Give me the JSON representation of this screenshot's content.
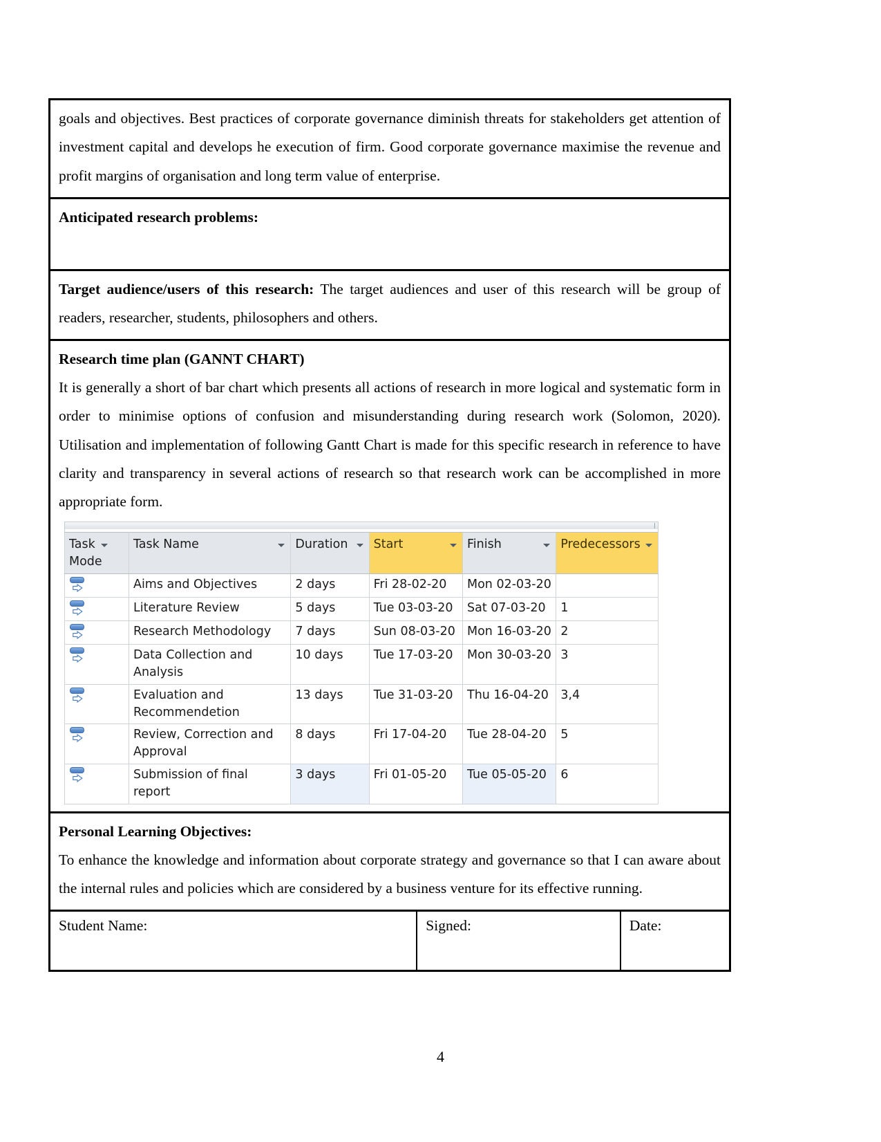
{
  "document": {
    "page_number": "4",
    "sections": {
      "intro_paragraph": "goals and objectives. Best practices of corporate governance diminish threats for stakeholders get attention of investment capital and develops he execution of firm. Good corporate governance maximise the revenue and profit margins of organisation and long term value of enterprise.",
      "anticipated_heading": "Anticipated research problems:",
      "target_audience_heading": "Target audience/users of this research:",
      "target_audience_body": " The target audiences and user of this research will be group of readers, researcher, students, philosophers and others.",
      "research_plan_heading": "Research time plan (GANNT CHART)",
      "research_plan_body": "It is generally a short of bar chart which presents all actions of research in more logical and systematic form in order to minimise options of confusion and misunderstanding during research work (Solomon, 2020). Utilisation and implementation of following Gantt Chart is made for this specific research in reference to have clarity and transparency in several actions of research so that research work can be accomplished in more appropriate form.",
      "personal_objectives_heading": "Personal Learning Objectives:",
      "personal_objectives_body": "To enhance the knowledge and information about corporate strategy and governance so that I can aware about the internal rules and policies which are considered by a business venture for its effective running."
    },
    "signature_row": {
      "student_name_label": "Student Name:",
      "signed_label": "Signed:",
      "date_label": "Date:"
    }
  },
  "chart_data": {
    "type": "table",
    "title": "Research time plan (GANNT CHART)",
    "columns": [
      "Task Mode",
      "Task Name",
      "Duration",
      "Start",
      "Finish",
      "Predecessors"
    ],
    "highlighted_columns": [
      "Start",
      "Predecessors"
    ],
    "rows": [
      {
        "task_mode": "manually-scheduled-task-icon",
        "name": "Aims and Objectives",
        "duration": "2 days",
        "start": "Fri 28-02-20",
        "finish": "Mon 02-03-20",
        "predecessors": ""
      },
      {
        "task_mode": "manually-scheduled-task-icon",
        "name": "Literature Review",
        "duration": "5 days",
        "start": "Tue 03-03-20",
        "finish": "Sat 07-03-20",
        "predecessors": "1"
      },
      {
        "task_mode": "manually-scheduled-task-icon",
        "name": "Research Methodology",
        "duration": "7 days",
        "start": "Sun 08-03-20",
        "finish": "Mon 16-03-20",
        "predecessors": "2"
      },
      {
        "task_mode": "manually-scheduled-task-icon",
        "name": "Data Collection and Analysis",
        "duration": "10 days",
        "start": "Tue 17-03-20",
        "finish": "Mon 30-03-20",
        "predecessors": "3"
      },
      {
        "task_mode": "manually-scheduled-task-icon",
        "name": "Evaluation and Recommendetion",
        "duration": "13 days",
        "start": "Tue 31-03-20",
        "finish": "Thu 16-04-20",
        "predecessors": "3,4"
      },
      {
        "task_mode": "manually-scheduled-task-icon",
        "name": "Review, Correction and Approval",
        "duration": "8 days",
        "start": "Fri 17-04-20",
        "finish": "Tue 28-04-20",
        "predecessors": "5"
      },
      {
        "task_mode": "manually-scheduled-task-icon",
        "name": "Submission of final report",
        "duration": "3 days",
        "start": "Fri 01-05-20",
        "finish": "Tue 05-05-20",
        "predecessors": "6"
      }
    ],
    "colors": {
      "header_background": "#e3e7eb",
      "header_highlight": "#fcd662",
      "grid_line": "#cfd4d9",
      "selected_cell": "#eaf0fa",
      "task_icon_blue": "#5d8fd0"
    }
  }
}
